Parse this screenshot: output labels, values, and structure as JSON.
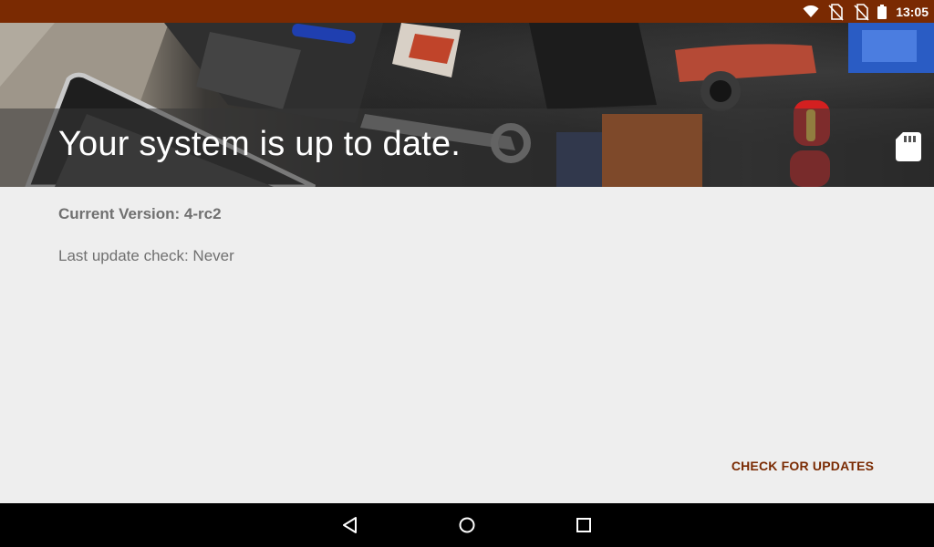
{
  "status_bar": {
    "time": "13:05",
    "icons": [
      "wifi-icon",
      "no-sim-icon",
      "no-sim-icon",
      "battery-icon"
    ]
  },
  "header": {
    "title": "Your system is up to date.",
    "action_icon": "sd-card-icon"
  },
  "info": {
    "current_version": "Current Version: 4-rc2",
    "last_check": "Last update check: Never"
  },
  "actions": {
    "check_updates_label": "CHECK FOR UPDATES"
  },
  "nav_bar": {
    "buttons": [
      "back-icon",
      "home-icon",
      "recents-icon"
    ]
  },
  "colors": {
    "accent": "#7a2a02",
    "text_secondary": "#707070",
    "background": "#eeeeee"
  }
}
